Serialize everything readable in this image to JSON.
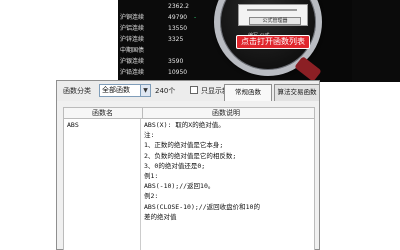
{
  "background_table": {
    "rows": [
      {
        "name": "",
        "value": "2362.2",
        "change": "",
        "change_color": "red"
      },
      {
        "name": "沪铜连续",
        "value": "49790",
        "change": "-",
        "change_color": "green"
      },
      {
        "name": "沪铝连续",
        "value": "13550",
        "change": "",
        "change_color": "green"
      },
      {
        "name": "沪锌连续",
        "value": "3325",
        "change": "",
        "change_color": "green"
      },
      {
        "name": "中期国债",
        "value": "",
        "change": "",
        "change_color": "green"
      },
      {
        "name": "沪银连续",
        "value": "3590",
        "change": "",
        "change_color": "green"
      },
      {
        "name": "沪铅连续",
        "value": "10950",
        "change": "",
        "change_color": "green"
      }
    ]
  },
  "magnifier": {
    "callout": "点击打开函数列表",
    "button_label": "公式管理器",
    "sub_label": "编写 公式"
  },
  "dialog": {
    "category_label": "函数分类",
    "category_value": "全部函数",
    "count_label": "240个",
    "checkbox_label": "只显示新函数",
    "tabs": [
      {
        "label": "常规函数",
        "active": true
      },
      {
        "label": "算法交易函数",
        "active": false
      }
    ],
    "columns": {
      "name": "函数名",
      "description": "函数说明"
    },
    "list": [
      {
        "name": "ABS"
      }
    ],
    "description_lines": [
      "ABS(X): 取的X的绝对值。",
      "注:",
      "1、正数的绝对值是它本身;",
      "2、负数的绝对值是它的相反数;",
      "3、0的绝对值还是0;",
      "例1:",
      "ABS(-10);//返回10。",
      "例2:",
      "ABS(CLOSE-10);//返回收盘价和10的",
      "差的绝对值"
    ]
  }
}
